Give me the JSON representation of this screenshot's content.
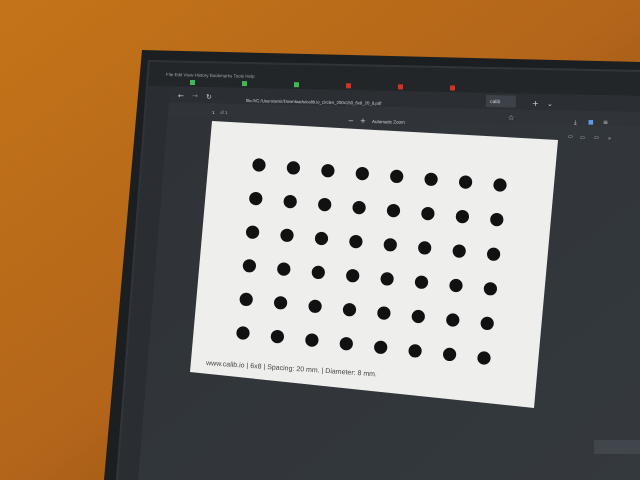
{
  "scene": {
    "wall_color": "#b86a18",
    "monitor_bezel_color": "#1e2124",
    "screen_color": "#3a3f44"
  },
  "browser": {
    "menu": [
      "File",
      "Edit",
      "View",
      "History",
      "Bookmarks",
      "Tools",
      "Help"
    ],
    "tab_colors": [
      "#3cba54",
      "#3cba54",
      "#3cba54",
      "#d93025",
      "#d93025",
      "#d93025"
    ],
    "active_tab_label": "calib",
    "url": "file:///C:/Users/amir/Downloads/calib.io_circles_200x150_6x8_20_8.pdf",
    "page_number": "1",
    "page_count": "of 1",
    "zoom": "Automatic Zoom"
  },
  "document": {
    "grid": {
      "rows": 6,
      "cols": 8
    },
    "dot_color": "#111111",
    "caption": "www.calib.io | 6x8 | Spacing: 20 mm. | Diameter: 8 mm."
  }
}
